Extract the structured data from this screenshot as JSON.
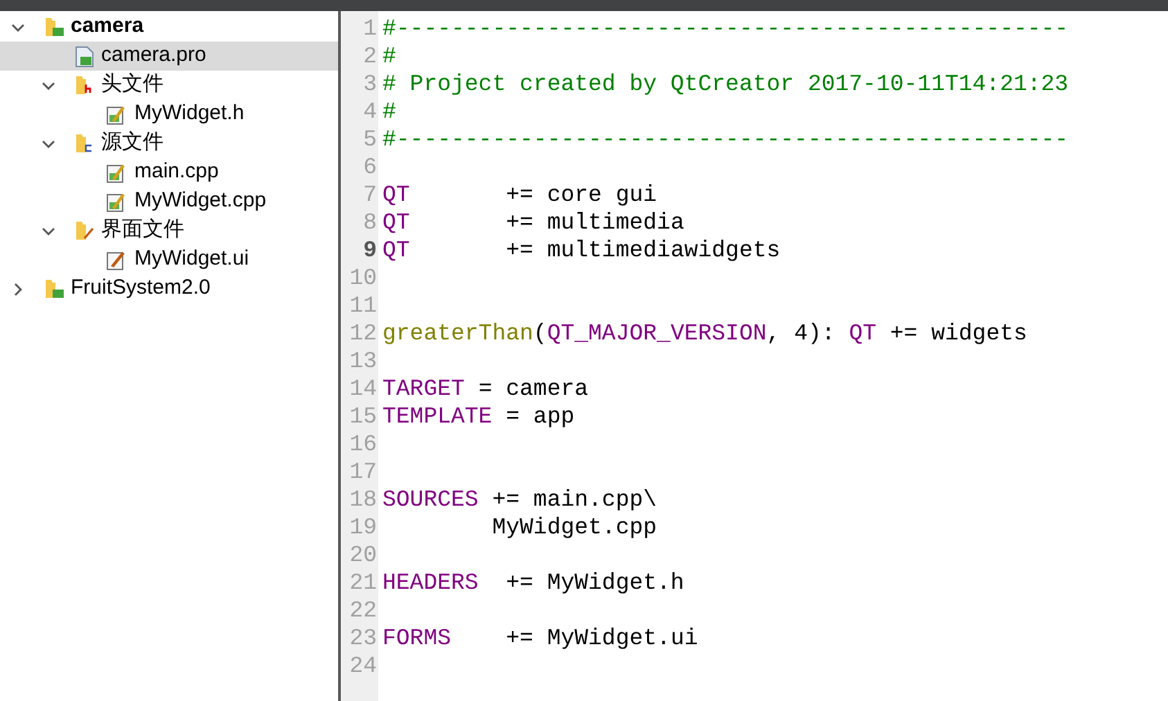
{
  "project_tree": [
    {
      "label": "camera",
      "kind": "project",
      "active": true,
      "expanded": true,
      "selected": false,
      "children": [
        {
          "label": "camera.pro",
          "kind": "pro-file",
          "selected": true
        },
        {
          "label": "头文件",
          "kind": "header-folder",
          "expanded": true,
          "selected": false,
          "children": [
            {
              "label": "MyWidget.h",
              "kind": "code-file",
              "selected": false
            }
          ]
        },
        {
          "label": "源文件",
          "kind": "source-folder",
          "expanded": true,
          "selected": false,
          "children": [
            {
              "label": "main.cpp",
              "kind": "code-file",
              "selected": false
            },
            {
              "label": "MyWidget.cpp",
              "kind": "code-file",
              "selected": false
            }
          ]
        },
        {
          "label": "界面文件",
          "kind": "form-folder",
          "expanded": true,
          "selected": false,
          "children": [
            {
              "label": "MyWidget.ui",
              "kind": "form-file",
              "selected": false
            }
          ]
        }
      ]
    },
    {
      "label": "FruitSystem2.0",
      "kind": "project",
      "active": false,
      "expanded": false,
      "selected": false
    }
  ],
  "editor": {
    "lines": [
      {
        "number": "1",
        "current": false,
        "segments": [
          {
            "kind": "comment",
            "text": "#-------------------------------------------------"
          }
        ]
      },
      {
        "number": "2",
        "current": false,
        "segments": [
          {
            "kind": "comment",
            "text": "#"
          }
        ]
      },
      {
        "number": "3",
        "current": false,
        "segments": [
          {
            "kind": "comment",
            "text": "# Project created by QtCreator 2017-10-11T14:21:23"
          }
        ]
      },
      {
        "number": "4",
        "current": false,
        "segments": [
          {
            "kind": "comment",
            "text": "#"
          }
        ]
      },
      {
        "number": "5",
        "current": false,
        "segments": [
          {
            "kind": "comment",
            "text": "#-------------------------------------------------"
          }
        ]
      },
      {
        "number": "6",
        "current": false
      },
      {
        "number": "7",
        "current": false,
        "segments": [
          {
            "kind": "variable",
            "text": "QT"
          },
          {
            "kind": "plain",
            "text": "       += core gui"
          }
        ]
      },
      {
        "number": "8",
        "current": false,
        "segments": [
          {
            "kind": "variable",
            "text": "QT"
          },
          {
            "kind": "plain",
            "text": "       += multimedia"
          }
        ]
      },
      {
        "number": "9",
        "current": true,
        "segments": [
          {
            "kind": "variable",
            "text": "QT"
          },
          {
            "kind": "plain",
            "text": "       += multimediawidgets"
          }
        ]
      },
      {
        "number": "10",
        "current": false
      },
      {
        "number": "11",
        "current": false
      },
      {
        "number": "12",
        "current": false,
        "segments": [
          {
            "kind": "function",
            "text": "greaterThan"
          },
          {
            "kind": "plain",
            "text": "("
          },
          {
            "kind": "variable",
            "text": "QT_MAJOR_VERSION"
          },
          {
            "kind": "plain",
            "text": ", 4): "
          },
          {
            "kind": "variable",
            "text": "QT"
          },
          {
            "kind": "plain",
            "text": " += widgets"
          }
        ]
      },
      {
        "number": "13",
        "current": false
      },
      {
        "number": "14",
        "current": false,
        "segments": [
          {
            "kind": "variable",
            "text": "TARGET"
          },
          {
            "kind": "plain",
            "text": " = camera"
          }
        ]
      },
      {
        "number": "15",
        "current": false,
        "segments": [
          {
            "kind": "variable",
            "text": "TEMPLATE"
          },
          {
            "kind": "plain",
            "text": " = app"
          }
        ]
      },
      {
        "number": "16",
        "current": false
      },
      {
        "number": "17",
        "current": false
      },
      {
        "number": "18",
        "current": false,
        "segments": [
          {
            "kind": "variable",
            "text": "SOURCES"
          },
          {
            "kind": "plain",
            "text": " += main.cpp\\"
          }
        ]
      },
      {
        "number": "19",
        "current": false,
        "segments": [
          {
            "kind": "plain",
            "text": "        MyWidget.cpp"
          }
        ]
      },
      {
        "number": "20",
        "current": false
      },
      {
        "number": "21",
        "current": false,
        "segments": [
          {
            "kind": "variable",
            "text": "HEADERS"
          },
          {
            "kind": "plain",
            "text": "  += MyWidget.h"
          }
        ]
      },
      {
        "number": "22",
        "current": false
      },
      {
        "number": "23",
        "current": false,
        "segments": [
          {
            "kind": "variable",
            "text": "FORMS"
          },
          {
            "kind": "plain",
            "text": "    += MyWidget.ui"
          }
        ]
      },
      {
        "number": "24",
        "current": false
      }
    ]
  }
}
